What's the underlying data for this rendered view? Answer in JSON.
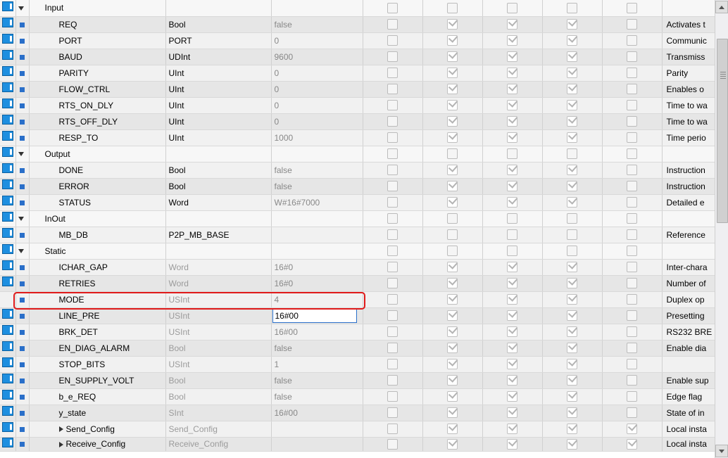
{
  "rows": [
    {
      "id": "input",
      "kind": "section",
      "name": "Input",
      "type": "",
      "val": "",
      "c": [
        0,
        0,
        0,
        0,
        0
      ],
      "com": "",
      "indent": 1,
      "expand": "down"
    },
    {
      "id": "req",
      "kind": "var",
      "name": "REQ",
      "type": "Bool",
      "val": "false",
      "c": [
        0,
        2,
        2,
        2,
        0
      ],
      "com": "Activates t",
      "indent": 2
    },
    {
      "id": "port",
      "kind": "var",
      "name": "PORT",
      "type": "PORT",
      "val": "0",
      "c": [
        0,
        2,
        2,
        2,
        0
      ],
      "com": "Communic",
      "indent": 2
    },
    {
      "id": "baud",
      "kind": "var",
      "name": "BAUD",
      "type": "UDInt",
      "val": "9600",
      "c": [
        0,
        2,
        2,
        2,
        0
      ],
      "com": "Transmiss",
      "indent": 2
    },
    {
      "id": "parity",
      "kind": "var",
      "name": "PARITY",
      "type": "UInt",
      "val": "0",
      "c": [
        0,
        2,
        2,
        2,
        0
      ],
      "com": "Parity",
      "indent": 2
    },
    {
      "id": "flowctrl",
      "kind": "var",
      "name": "FLOW_CTRL",
      "type": "UInt",
      "val": "0",
      "c": [
        0,
        2,
        2,
        2,
        0
      ],
      "com": "Enables o",
      "indent": 2
    },
    {
      "id": "rtsondly",
      "kind": "var",
      "name": "RTS_ON_DLY",
      "type": "UInt",
      "val": "0",
      "c": [
        0,
        2,
        2,
        2,
        0
      ],
      "com": "Time to wa",
      "indent": 2
    },
    {
      "id": "rtsoffdly",
      "kind": "var",
      "name": "RTS_OFF_DLY",
      "type": "UInt",
      "val": "0",
      "c": [
        0,
        2,
        2,
        2,
        0
      ],
      "com": "Time to wa",
      "indent": 2
    },
    {
      "id": "respto",
      "kind": "var",
      "name": "RESP_TO",
      "type": "UInt",
      "val": "1000",
      "c": [
        0,
        2,
        2,
        2,
        0
      ],
      "com": "Time perio",
      "indent": 2
    },
    {
      "id": "output",
      "kind": "section",
      "name": "Output",
      "type": "",
      "val": "",
      "c": [
        0,
        0,
        0,
        0,
        0
      ],
      "com": "",
      "indent": 1,
      "expand": "down"
    },
    {
      "id": "done",
      "kind": "var",
      "name": "DONE",
      "type": "Bool",
      "val": "false",
      "c": [
        0,
        2,
        2,
        2,
        0
      ],
      "com": "Instruction",
      "indent": 2
    },
    {
      "id": "error",
      "kind": "var",
      "name": "ERROR",
      "type": "Bool",
      "val": "false",
      "c": [
        0,
        2,
        2,
        2,
        0
      ],
      "com": "Instruction",
      "indent": 2
    },
    {
      "id": "status",
      "kind": "var",
      "name": "STATUS",
      "type": "Word",
      "val": "W#16#7000",
      "c": [
        0,
        2,
        2,
        2,
        0
      ],
      "com": "Detailed e",
      "indent": 2
    },
    {
      "id": "inout",
      "kind": "section",
      "name": "InOut",
      "type": "",
      "val": "",
      "c": [
        0,
        0,
        0,
        0,
        0
      ],
      "com": "",
      "indent": 1,
      "expand": "down"
    },
    {
      "id": "mbdb",
      "kind": "var",
      "name": "MB_DB",
      "type": "P2P_MB_BASE",
      "val": "",
      "c": [
        0,
        0,
        0,
        0,
        0
      ],
      "com": "Reference",
      "indent": 2
    },
    {
      "id": "static",
      "kind": "section",
      "name": "Static",
      "type": "",
      "val": "",
      "c": [
        0,
        0,
        0,
        0,
        0
      ],
      "com": "",
      "indent": 1,
      "expand": "down"
    },
    {
      "id": "ichargap",
      "kind": "var",
      "name": "ICHAR_GAP",
      "type": "Word",
      "typedis": true,
      "val": "16#0",
      "c": [
        0,
        2,
        2,
        2,
        0
      ],
      "com": "Inter-chara",
      "indent": 2
    },
    {
      "id": "retries",
      "kind": "var",
      "name": "RETRIES",
      "type": "Word",
      "typedis": true,
      "val": "16#0",
      "c": [
        0,
        2,
        2,
        2,
        0
      ],
      "com": "Number of",
      "indent": 2
    },
    {
      "id": "mode",
      "kind": "var",
      "name": "MODE",
      "type": "USInt",
      "typedis": true,
      "val": "4",
      "c": [
        0,
        2,
        2,
        2,
        0
      ],
      "com": "Duplex op",
      "indent": 2,
      "highlight": true,
      "noicon": true
    },
    {
      "id": "linepre",
      "kind": "var",
      "name": "LINE_PRE",
      "type": "USInt",
      "typedis": true,
      "val": "16#00",
      "valedit": true,
      "c": [
        0,
        2,
        2,
        2,
        0
      ],
      "com": "Presetting",
      "indent": 2
    },
    {
      "id": "brkdet",
      "kind": "var",
      "name": "BRK_DET",
      "type": "USInt",
      "typedis": true,
      "val": "16#00",
      "c": [
        0,
        2,
        2,
        2,
        0
      ],
      "com": "RS232 BRE",
      "indent": 2
    },
    {
      "id": "endiag",
      "kind": "var",
      "name": "EN_DIAG_ALARM",
      "type": "Bool",
      "typedis": true,
      "val": "false",
      "c": [
        0,
        2,
        2,
        2,
        0
      ],
      "com": "Enable dia",
      "indent": 2
    },
    {
      "id": "stopbits",
      "kind": "var",
      "name": "STOP_BITS",
      "type": "USInt",
      "typedis": true,
      "val": "1",
      "c": [
        0,
        2,
        2,
        2,
        0
      ],
      "com": "",
      "indent": 2
    },
    {
      "id": "ensupply",
      "kind": "var",
      "name": "EN_SUPPLY_VOLT",
      "type": "Bool",
      "typedis": true,
      "val": "false",
      "c": [
        0,
        2,
        2,
        2,
        0
      ],
      "com": "Enable sup",
      "indent": 2
    },
    {
      "id": "bereq",
      "kind": "var",
      "name": "b_e_REQ",
      "type": "Bool",
      "typedis": true,
      "val": "false",
      "c": [
        0,
        2,
        2,
        2,
        0
      ],
      "com": "Edge flag ",
      "indent": 2
    },
    {
      "id": "ystate",
      "kind": "var",
      "name": "y_state",
      "type": "SInt",
      "typedis": true,
      "val": "16#00",
      "c": [
        0,
        2,
        2,
        2,
        0
      ],
      "com": "State of in",
      "indent": 2
    },
    {
      "id": "sendcfg",
      "kind": "var",
      "name": "Send_Config",
      "type": "Send_Config",
      "typedis": true,
      "val": "",
      "c": [
        0,
        2,
        2,
        2,
        2
      ],
      "com": "Local insta",
      "indent": 2,
      "expand": "right"
    },
    {
      "id": "recvcfg",
      "kind": "var",
      "name": "Receive_Config",
      "type": "Receive_Config",
      "typedis": true,
      "val": "",
      "c": [
        0,
        2,
        2,
        2,
        2
      ],
      "com": "Local insta",
      "indent": 2,
      "expand": "right",
      "cut": true
    }
  ]
}
